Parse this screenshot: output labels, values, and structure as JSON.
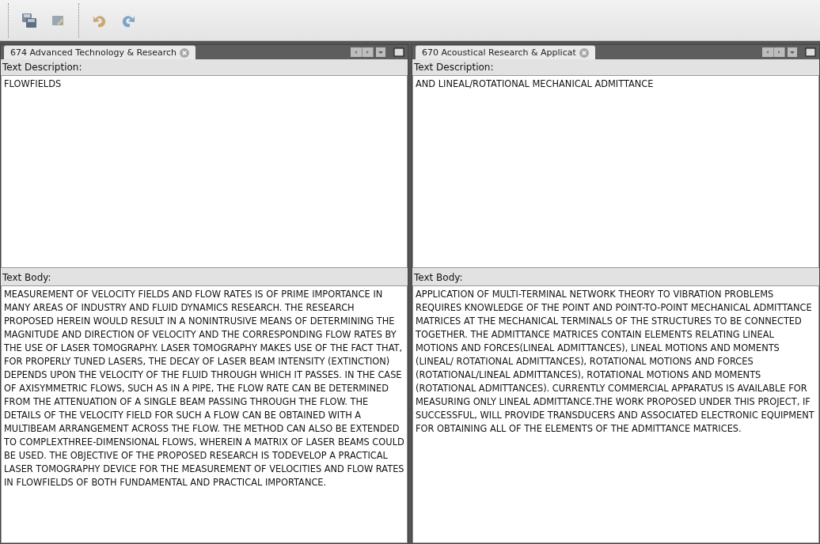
{
  "panels": [
    {
      "tab": {
        "label": "674 Advanced Technology & Research",
        "selected": true
      },
      "description_label": "Text Description:",
      "description": "FLOWFIELDS",
      "body_label": "Text Body:",
      "body": "MEASUREMENT OF VELOCITY FIELDS AND FLOW RATES IS OF PRIME IMPORTANCE IN MANY AREAS OF INDUSTRY AND FLUID DYNAMICS RESEARCH. THE RESEARCH PROPOSED HEREIN WOULD RESULT IN A NONINTRUSIVE MEANS OF DETERMINING THE MAGNITUDE AND DIRECTION OF VELOCITY AND THE CORRESPONDING FLOW RATES BY THE USE OF LASER TOMOGRAPHY. LASER TOMOGRAPHY MAKES USE OF THE FACT THAT, FOR PROPERLY TUNED LASERS, THE DECAY OF LASER BEAM INTENSITY (EXTINCTION) DEPENDS UPON THE VELOCITY OF THE FLUID THROUGH WHICH IT PASSES. IN THE CASE OF AXISYMMETRIC FLOWS, SUCH AS IN A PIPE, THE FLOW RATE CAN BE DETERMINED FROM THE ATTENUATION OF A SINGLE BEAM PASSING THROUGH THE FLOW. THE DETAILS OF THE VELOCITY FIELD FOR SUCH A FLOW CAN BE OBTAINED WITH A MULTIBEAM ARRANGEMENT ACROSS THE FLOW. THE METHOD CAN ALSO BE EXTENDED TO COMPLEXTHREE-DIMENSIONAL FLOWS, WHEREIN A MATRIX OF LASER BEAMS COULD BE USED. THE OBJECTIVE OF THE PROPOSED RESEARCH IS TODEVELOP A PRACTICAL LASER TOMOGRAPHY DEVICE FOR THE MEASUREMENT OF VELOCITIES AND FLOW RATES IN FLOWFIELDS OF BOTH FUNDAMENTAL AND PRACTICAL IMPORTANCE."
    },
    {
      "tab": {
        "label": "670 Acoustical Research & Applicat",
        "selected": true
      },
      "description_label": "Text Description:",
      "description": "AND LINEAL/ROTATIONAL MECHANICAL ADMITTANCE",
      "body_label": "Text Body:",
      "body": "APPLICATION OF MULTI-TERMINAL NETWORK THEORY TO VIBRATION PROBLEMS REQUIRES KNOWLEDGE OF THE POINT AND POINT-TO-POINT MECHANICAL ADMITTANCE MATRICES AT THE MECHANICAL TERMINALS OF THE STRUCTURES TO BE CONNECTED TOGETHER. THE ADMITTANCE MATRICES CONTAIN ELEMENTS RELATING LINEAL MOTIONS AND FORCES(LINEAL ADMITTANCES), LINEAL MOTIONS AND MOMENTS (LINEAL/ ROTATIONAL ADMITTANCES), ROTATIONAL MOTIONS AND FORCES (ROTATIONAL/LINEAL ADMITTANCES), ROTATIONAL MOTIONS AND MOMENTS (ROTATIONAL ADMITTANCES). CURRENTLY COMMERCIAL APPARATUS IS AVAILABLE FOR MEASURING ONLY LINEAL ADMITTANCE.THE WORK PROPOSED UNDER THIS PROJECT, IF SUCCESSFUL, WILL PROVIDE TRANSDUCERS AND ASSOCIATED ELECTRONIC EQUIPMENT FOR OBTAINING ALL OF THE ELEMENTS OF THE ADMITTANCE MATRICES."
    }
  ]
}
